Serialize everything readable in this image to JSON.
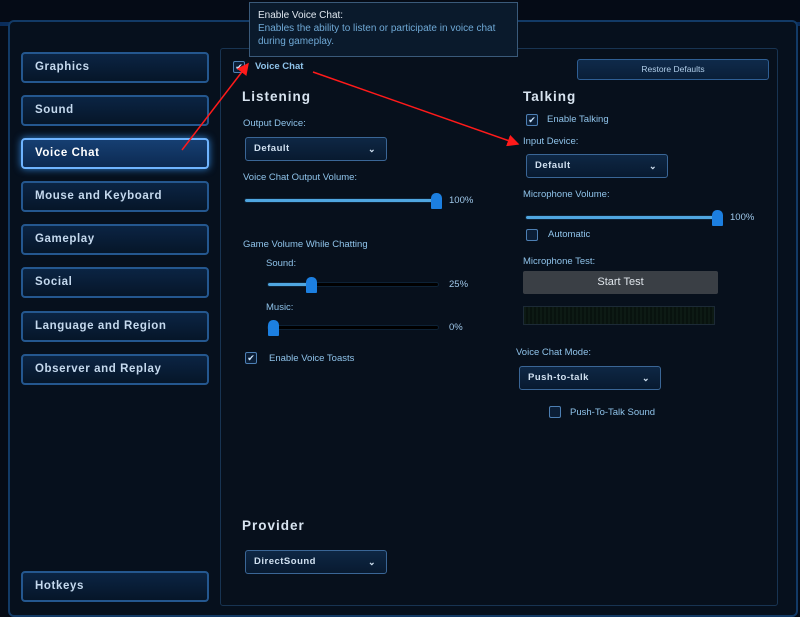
{
  "sidebar": {
    "items": [
      {
        "label": "Graphics"
      },
      {
        "label": "Sound"
      },
      {
        "label": "Voice Chat",
        "active": true
      },
      {
        "label": "Mouse and Keyboard"
      },
      {
        "label": "Gameplay"
      },
      {
        "label": "Social"
      },
      {
        "label": "Language and Region"
      },
      {
        "label": "Observer and Replay"
      }
    ],
    "hotkeys": "Hotkeys"
  },
  "tooltip": {
    "title": "Enable Voice Chat:",
    "body": "Enables the ability to listen or participate in voice chat during gameplay."
  },
  "voice_chat": {
    "label": "Voice Chat",
    "checked": true
  },
  "restore_defaults": "Restore Defaults",
  "listening": {
    "heading": "Listening",
    "output_device_label": "Output Device:",
    "output_device": "Default",
    "output_volume_label": "Voice Chat Output Volume:",
    "output_volume": 100,
    "output_volume_text": "100%",
    "game_volume_label": "Game Volume While Chatting",
    "sound_label": "Sound:",
    "sound": 25,
    "sound_text": "25%",
    "music_label": "Music:",
    "music": 0,
    "music_text": "0%",
    "toasts_label": "Enable Voice Toasts",
    "toasts_checked": true
  },
  "provider": {
    "heading": "Provider",
    "value": "DirectSound"
  },
  "talking": {
    "heading": "Talking",
    "enable_label": "Enable Talking",
    "enable_checked": true,
    "input_device_label": "Input Device:",
    "input_device": "Default",
    "mic_volume_label": "Microphone Volume:",
    "mic_volume": 100,
    "mic_volume_text": "100%",
    "automatic_label": "Automatic",
    "automatic_checked": false,
    "mic_test_label": "Microphone Test:",
    "start_test": "Start Test",
    "mode_label": "Voice Chat Mode:",
    "mode": "Push-to-talk",
    "ptt_sound_label": "Push-To-Talk Sound",
    "ptt_sound_checked": false
  },
  "icons": {
    "check": "✔",
    "chevron": "⌄"
  },
  "colors": {
    "accent": "#1c7fe0",
    "annotation_arrow": "#ff1a1a"
  }
}
